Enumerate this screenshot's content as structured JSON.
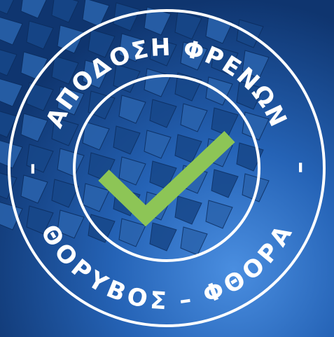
{
  "badge": {
    "top_text": "ΑΠΟΔΟΣΗ ΦΡΕΝΩΝ",
    "bottom_text": "ΘΟΡΥΒΟΣ – ΦΘΟΡΑ",
    "left_separator": "–",
    "right_separator": "–",
    "check_icon": "checkmark-icon"
  },
  "colors": {
    "background_dark": "#0d2f66",
    "background_mid": "#1f5aa8",
    "background_light": "#3d7fd4",
    "ring": "#ffffff",
    "check": "#8dc556"
  }
}
